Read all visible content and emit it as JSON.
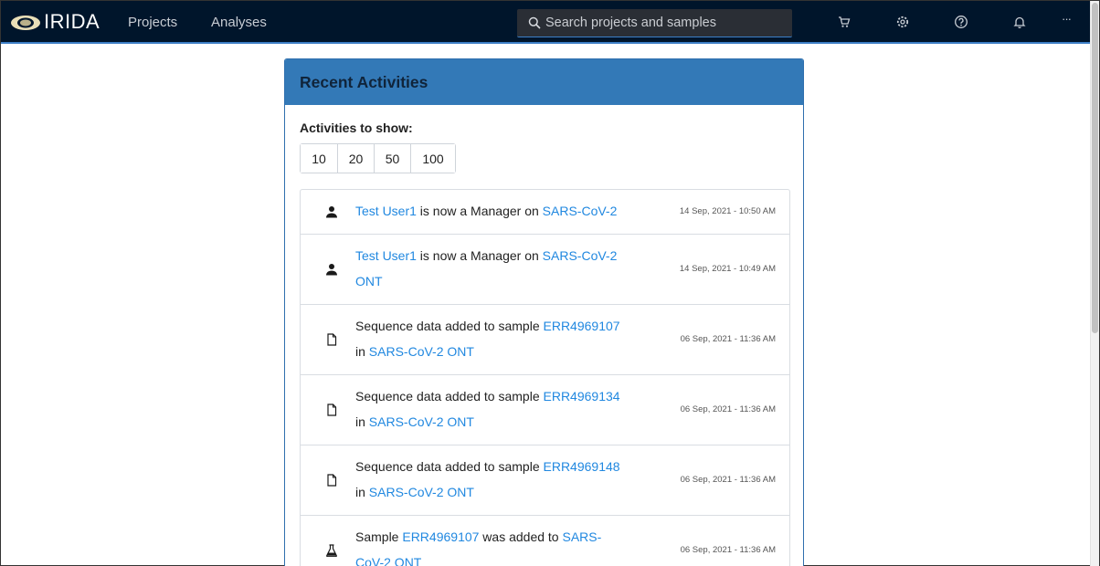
{
  "app": {
    "name": "IRIDA"
  },
  "nav": {
    "projects": "Projects",
    "analyses": "Analyses",
    "search_placeholder": "Search projects and samples",
    "more": "···"
  },
  "colors": {
    "topbar": "#00152b",
    "accent": "#3379b7",
    "link": "#2188e0"
  },
  "card": {
    "title": "Recent Activities",
    "show_label": "Activities to show:",
    "page_sizes": [
      "10",
      "20",
      "50",
      "100"
    ]
  },
  "activities": [
    {
      "icon": "user-icon",
      "user": "Test User1",
      "mid": " is now a Manager on ",
      "target": "SARS-CoV-2",
      "tail": "",
      "time": "14 Sep, 2021 - 10:50 AM"
    },
    {
      "icon": "user-icon",
      "user": "Test User1",
      "mid": " is now a Manager on ",
      "target": "SARS-CoV-2 ONT",
      "tail": "",
      "time": "14 Sep, 2021 - 10:49 AM"
    },
    {
      "icon": "file-icon",
      "pre": "Sequence data added to sample ",
      "sample": "ERR4969107",
      "mid": " in ",
      "project": "SARS-CoV-2 ONT",
      "time": "06 Sep, 2021 - 11:36 AM"
    },
    {
      "icon": "file-icon",
      "pre": "Sequence data added to sample ",
      "sample": "ERR4969134",
      "mid": " in ",
      "project": "SARS-CoV-2 ONT",
      "time": "06 Sep, 2021 - 11:36 AM"
    },
    {
      "icon": "file-icon",
      "pre": "Sequence data added to sample ",
      "sample": "ERR4969148",
      "mid": " in ",
      "project": "SARS-CoV-2 ONT",
      "time": "06 Sep, 2021 - 11:36 AM"
    },
    {
      "icon": "flask-icon",
      "pre": "Sample ",
      "sample": "ERR4969107",
      "mid": " was added to ",
      "project": "SARS-CoV-2 ONT",
      "time": "06 Sep, 2021 - 11:36 AM"
    }
  ]
}
